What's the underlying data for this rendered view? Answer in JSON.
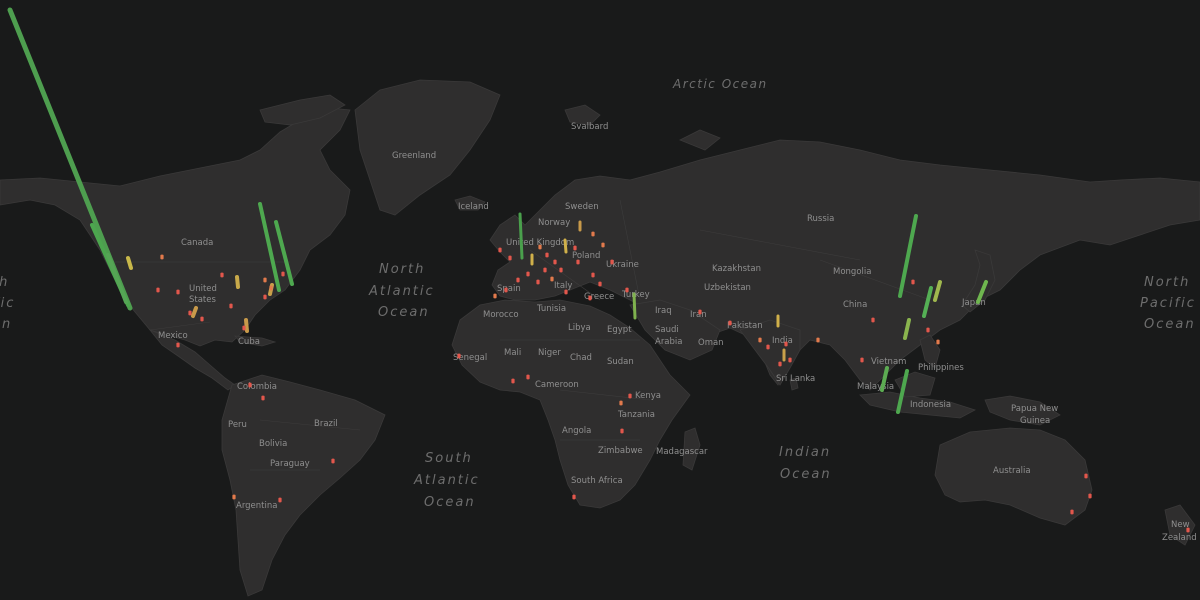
{
  "map": {
    "colors": {
      "background": "#191a1a",
      "land": "#2f2e2e",
      "label": "#8f8f8f",
      "ocean_label": "#6d6d6d",
      "bar_high": "#4caf50",
      "bar_mid": "#c8b84a",
      "bar_low": "#e2574c"
    },
    "country_labels": [
      "Greenland",
      "Iceland",
      "Svalbard",
      "Norway",
      "Sweden",
      "Russia",
      "United Kingdom",
      "Poland",
      "Ukraine",
      "Spain",
      "Italy",
      "Greece",
      "Turkey",
      "Kazakhstan",
      "Uzbekistan",
      "Mongolia",
      "China",
      "Japan",
      "Morocco",
      "Tunisia",
      "Libya",
      "Egypt",
      "Saudi Arabia",
      "Iraq",
      "Iran",
      "Oman",
      "Pakistan",
      "India",
      "Sri Lanka",
      "Vietnam",
      "Philippines",
      "Malaysia",
      "Indonesia",
      "Papua New Guinea",
      "Australia",
      "New Zealand",
      "Canada",
      "United States",
      "Mexico",
      "Cuba",
      "Colombia",
      "Peru",
      "Brazil",
      "Bolivia",
      "Paraguay",
      "Argentina",
      "Senegal",
      "Mali",
      "Niger",
      "Chad",
      "Sudan",
      "Cameroon",
      "Kenya",
      "Tanzania",
      "Angola",
      "Zimbabwe",
      "Madagascar",
      "South Africa"
    ],
    "ocean_labels": [
      "Arctic Ocean",
      "North Atlantic Ocean",
      "South Atlantic Ocean",
      "Indian Ocean",
      "North Pacific Ocean"
    ]
  }
}
